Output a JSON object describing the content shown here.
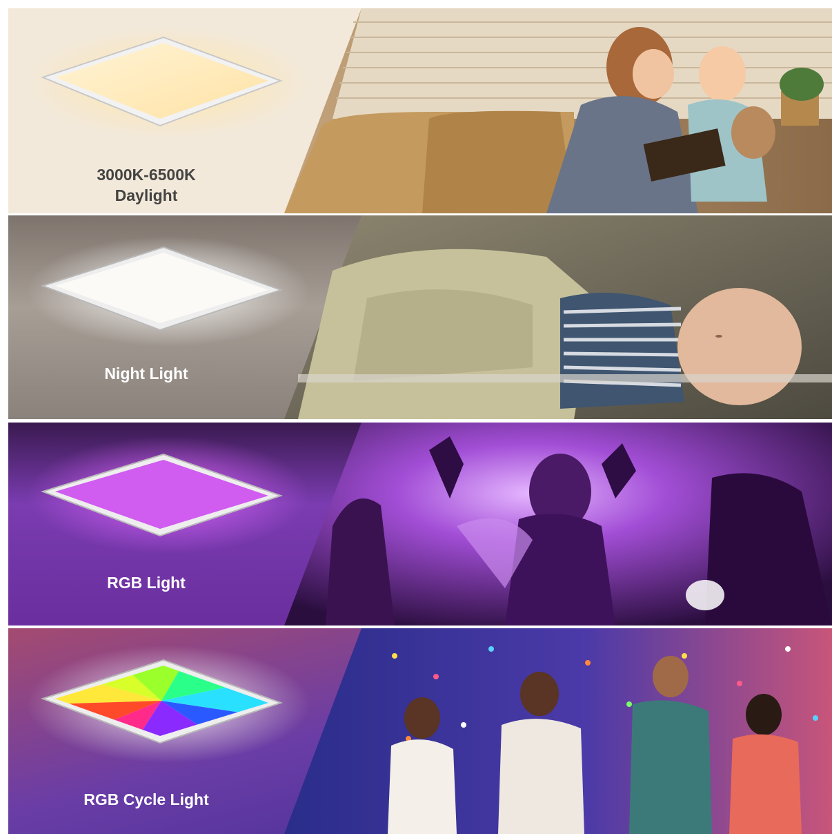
{
  "panels": [
    {
      "id": "daylight",
      "label_line1": "3000K-6500K",
      "label_line2": "Daylight",
      "label_color": "#444444",
      "bg_color": "#f1e6d6",
      "panel_color": "#fff1cf",
      "glow_color": "#ffd890"
    },
    {
      "id": "night",
      "label_line1": "Night Light",
      "label_color": "#ffffff",
      "bg_color": "#8f8680",
      "panel_color": "#fbfaf6",
      "glow_color": "#ffffff"
    },
    {
      "id": "rgb",
      "label_line1": "RGB Light",
      "label_color": "#ffffff",
      "bg_color": "#6e2ea6",
      "panel_color": "#d05cf0",
      "glow_color": "#c84cff"
    },
    {
      "id": "rgb-cycle",
      "label_line1": "RGB Cycle Light",
      "label_color": "#ffffff",
      "bg_color": "#5a3aa0",
      "panel_color": "multicolor",
      "glow_color": "#ffffff"
    }
  ]
}
